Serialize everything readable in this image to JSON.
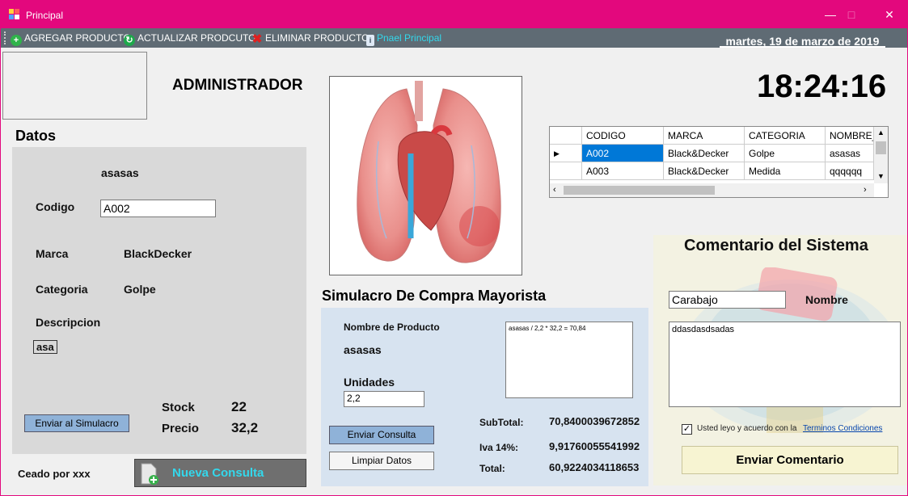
{
  "window": {
    "title": "Principal"
  },
  "menu": {
    "items": [
      {
        "label": "AGREGAR PRODUCTO",
        "icon": "add-icon"
      },
      {
        "label": "ACTUALIZAR PRODCUTO",
        "icon": "refresh-icon"
      },
      {
        "label": "ELIMINAR PRODUCTO",
        "icon": "delete-icon"
      },
      {
        "label": "Pnael Principal",
        "icon": "panel-icon"
      }
    ],
    "date": "martes, 19 de marzo de 2019"
  },
  "header": {
    "user_role": "ADMINISTRADOR",
    "clock": "18:24:16"
  },
  "datos": {
    "title": "Datos",
    "product_name": "asasas",
    "codigo_label": "Codigo",
    "codigo_value": "A002",
    "marca_label": "Marca",
    "marca_value": "BlackDecker",
    "categoria_label": "Categoria",
    "categoria_value": "Golpe",
    "descripcion_label": "Descripcion",
    "descripcion_value": "asa",
    "send_button": "Enviar al Simulacro",
    "stock_label": "Stock",
    "stock_value": "22",
    "precio_label": "Precio",
    "precio_value": "32,2"
  },
  "footer": {
    "credit": "Ceado por xxx",
    "new_query_button": "Nueva Consulta"
  },
  "grid": {
    "columns": [
      "CODIGO",
      "MARCA",
      "CATEGORIA",
      "NOMBRE_"
    ],
    "rows": [
      [
        "A002",
        "Black&Decker",
        "Golpe",
        "asasas"
      ],
      [
        "A003",
        "Black&Decker",
        "Medida",
        "qqqqqq"
      ]
    ],
    "selected_row": 0
  },
  "simulacro": {
    "title": "Simulacro De Compra Mayorista",
    "product_label": "Nombre de Producto",
    "product_value": "asasas",
    "units_label": "Unidades",
    "units_value": "2,2",
    "calc_log": "asasas / 2,2 * 32,2 = 70,84",
    "send_button": "Enviar Consulta",
    "clear_button": "Limpiar Datos",
    "subtotal_label": "SubTotal:",
    "subtotal_value": "70,8400039672852",
    "iva_label": "Iva 14%:",
    "iva_value": "9,91760055541992",
    "total_label": "Total:",
    "total_value": "60,9224034118653"
  },
  "comentario": {
    "title": "Comentario del Sistema",
    "name_value": "Carabajo",
    "name_label": "Nombre",
    "comment_text": "ddasdasdsadas",
    "terms_text": "Usted leyo y acuerdo con la",
    "terms_link": "Terminos Condiciones",
    "terms_checked": true,
    "send_button": "Enviar Comentario"
  },
  "colors": {
    "titlebar": "#e3087d",
    "menubar": "#5f6b74",
    "selected_row": "#0078d7",
    "new_query_text": "#33d8ec"
  }
}
